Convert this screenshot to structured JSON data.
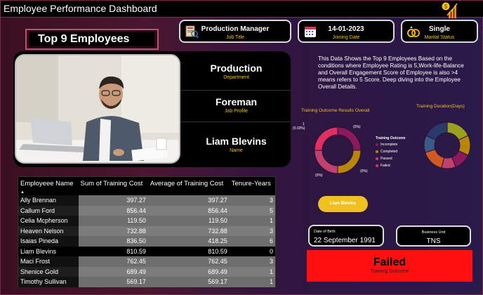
{
  "header": {
    "title": "Employee Performance  Dashboard"
  },
  "cards": {
    "job_title": {
      "value": "Production Manager",
      "label": "Job Title"
    },
    "joining_date": {
      "value": "14-01-2023",
      "label": "Joining Date"
    },
    "marital_status": {
      "value": "Single",
      "label": "Marital Status"
    }
  },
  "top_heading": "Top 9 Employees",
  "employee": {
    "department": {
      "value": "Production",
      "label": "Department"
    },
    "job_profile": {
      "value": "Foreman",
      "label": "Job Profile"
    },
    "name": {
      "value": "Liam Blevins",
      "label": "Name"
    }
  },
  "description": "This Data Shows the Top 9 Employees Based on the conditions where Employee Rating is 5,Work-life-Balance and Overall Engagement Score of Employee is also >4 means refers to 5 Score. Deep diving into the Employee Overall Details.",
  "charts_titles": {
    "outcome": "Training Outcome Results Overall",
    "duration": "Training Duration(Days)"
  },
  "legend": {
    "title": "Training Outcome",
    "items": [
      {
        "label": "Incomplete",
        "color": "#8b1a5c"
      },
      {
        "label": "Completed",
        "color": "#b8860b"
      },
      {
        "label": "Passed",
        "color": "#c04070"
      },
      {
        "label": "Failed",
        "color": "#e03060"
      }
    ]
  },
  "donut_labels": [
    "1",
    "(0.03%)",
    "(0%)",
    "(0%)",
    "(0%)"
  ],
  "chart_data": [
    {
      "type": "pie",
      "title": "Training Outcome Results Overall",
      "categories": [
        "Incomplete",
        "Completed",
        "Passed",
        "Failed"
      ],
      "values": [
        25,
        25,
        25,
        25
      ],
      "colors": [
        "#8b1a5c",
        "#b8860b",
        "#c04070",
        "#e03060"
      ]
    },
    {
      "type": "pie",
      "title": "Training Duration(Days)",
      "categories": [
        "",
        "",
        "",
        "",
        "",
        "",
        ""
      ],
      "values": [
        18,
        14,
        12,
        10,
        16,
        12,
        18
      ],
      "colors": [
        "#9aa020",
        "#b8860b",
        "#8b1a5c",
        "#c04070",
        "#d05a20",
        "#3a5a8a",
        "#2a3a6a"
      ]
    }
  ],
  "name_button": "Liam Blevins",
  "table": {
    "columns": [
      "Employeee Name",
      "Sum of Training Cost",
      "Average of Training Cost",
      "Tenure-Years"
    ],
    "rows": [
      [
        "Ally Brennan",
        "397.27",
        "397.27",
        "3"
      ],
      [
        "Callum Ford",
        "856.44",
        "856.44",
        "5"
      ],
      [
        "Celia Mcpherson",
        "119.50",
        "119.50",
        "1"
      ],
      [
        "Heaven Nelson",
        "732.88",
        "732.88",
        "3"
      ],
      [
        "Isaias Pineda",
        "836.50",
        "418.25",
        "6"
      ],
      [
        "Liam Blevins",
        "810.59",
        "810.59",
        "0"
      ],
      [
        "Maci Frost",
        "762.45",
        "762.45",
        "3"
      ],
      [
        "Shenice Gold",
        "689.49",
        "689.49",
        "1"
      ],
      [
        "Timothy Sullivan",
        "569.17",
        "569.17",
        "1"
      ]
    ]
  },
  "dob": {
    "label": "Date of Birth",
    "value": "22 September 1991"
  },
  "business_unit": {
    "label": "Business Unit",
    "value": "TNS"
  },
  "outcome": {
    "value": "Failed",
    "label": "Training Outcome"
  }
}
